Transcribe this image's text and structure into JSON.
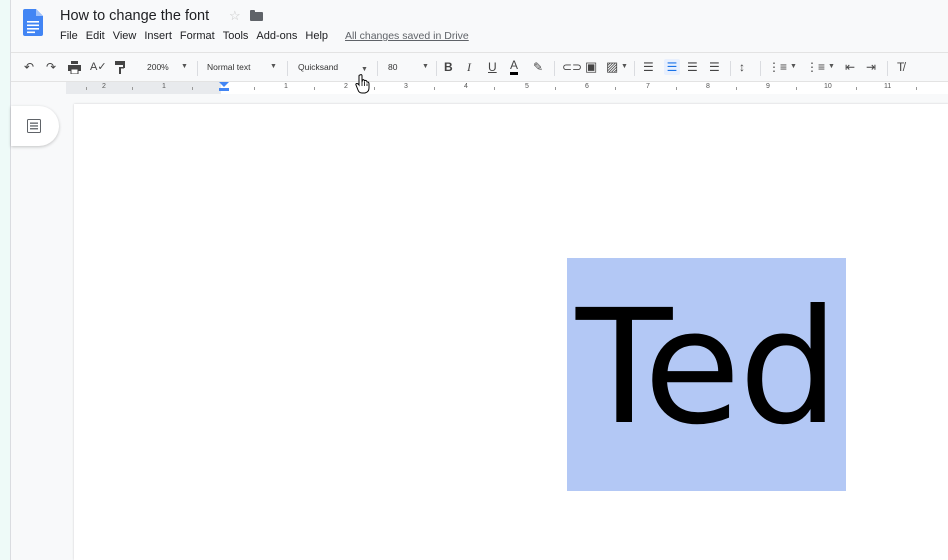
{
  "document": {
    "title": "How to change the font",
    "save_status": "All changes saved in Drive"
  },
  "menu": [
    "File",
    "Edit",
    "View",
    "Insert",
    "Format",
    "Tools",
    "Add-ons",
    "Help"
  ],
  "toolbar": {
    "zoom": "200%",
    "style": "Normal text",
    "font": "Quicksand",
    "font_size": "80",
    "bold": "B",
    "italic": "I",
    "underline": "U",
    "text_color": "A"
  },
  "ruler": {
    "labels": [
      "2",
      "1",
      "1",
      "2",
      "3",
      "4",
      "5",
      "6",
      "7",
      "8",
      "9",
      "10",
      "11"
    ]
  },
  "content": {
    "selected_text": "Ted"
  },
  "colors": {
    "selection": "#b3c8f5",
    "accent": "#1a73e8",
    "docs_blue": "#4285f4"
  }
}
